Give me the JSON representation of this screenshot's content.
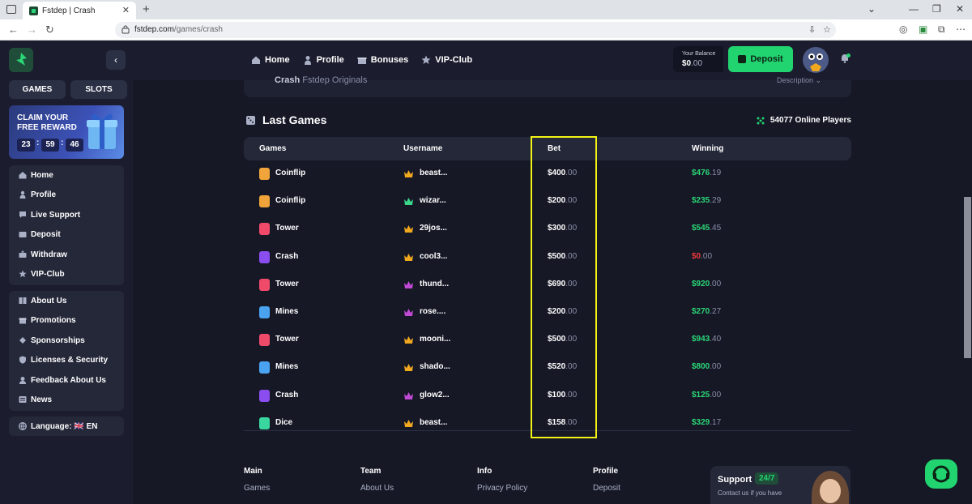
{
  "browser": {
    "tab_title": "Fstdep | Crash",
    "url_host": "fstdep.com",
    "url_path": "/games/crash"
  },
  "header": {
    "nav": [
      "Home",
      "Profile",
      "Bonuses",
      "VIP-Club"
    ],
    "balance_label": "Your Balance",
    "balance_main": "$0",
    "balance_cents": ".00",
    "deposit_label": "Deposit"
  },
  "sidebar": {
    "tabs": [
      "GAMES",
      "SLOTS"
    ],
    "reward_line1": "CLAIM YOUR",
    "reward_line2": "FREE REWARD",
    "timer": [
      "23",
      "59",
      "46"
    ],
    "group1": [
      "Home",
      "Profile",
      "Live Support",
      "Deposit",
      "Withdraw",
      "VIP-Club"
    ],
    "group2": [
      "About Us",
      "Promotions",
      "Sponsorships",
      "Licenses & Security",
      "Feedback About Us",
      "News"
    ],
    "language": "Language: 🇬🇧 EN"
  },
  "crash_card": {
    "name": "Crash",
    "sub": "Fstdep Originals",
    "description": "Description"
  },
  "last_games": {
    "title": "Last Games",
    "online": "54077 Online Players",
    "columns": [
      "Games",
      "Username",
      "Bet",
      "Winning"
    ],
    "rows": [
      {
        "game": "Coinflip",
        "user": "beast...",
        "bet": "$400",
        "bet_c": ".00",
        "win": "$476",
        "win_c": ".19"
      },
      {
        "game": "Coinflip",
        "user": "wizar...",
        "bet": "$200",
        "bet_c": ".00",
        "win": "$235",
        "win_c": ".29"
      },
      {
        "game": "Tower",
        "user": "29jos...",
        "bet": "$300",
        "bet_c": ".00",
        "win": "$545",
        "win_c": ".45"
      },
      {
        "game": "Crash",
        "user": "cool3...",
        "bet": "$500",
        "bet_c": ".00",
        "win": "$0",
        "win_c": ".00"
      },
      {
        "game": "Tower",
        "user": "thund...",
        "bet": "$690",
        "bet_c": ".00",
        "win": "$920",
        "win_c": ".00"
      },
      {
        "game": "Mines",
        "user": "rose....",
        "bet": "$200",
        "bet_c": ".00",
        "win": "$270",
        "win_c": ".27"
      },
      {
        "game": "Tower",
        "user": "mooni...",
        "bet": "$500",
        "bet_c": ".00",
        "win": "$943",
        "win_c": ".40"
      },
      {
        "game": "Mines",
        "user": "shado...",
        "bet": "$520",
        "bet_c": ".00",
        "win": "$800",
        "win_c": ".00"
      },
      {
        "game": "Crash",
        "user": "glow2...",
        "bet": "$100",
        "bet_c": ".00",
        "win": "$125",
        "win_c": ".00"
      },
      {
        "game": "Dice",
        "user": "beast...",
        "bet": "$158",
        "bet_c": ".00",
        "win": "$329",
        "win_c": ".17"
      }
    ]
  },
  "footer": {
    "cols": [
      {
        "head": "Main",
        "link": "Games"
      },
      {
        "head": "Team",
        "link": "About Us"
      },
      {
        "head": "Info",
        "link": "Privacy Policy"
      },
      {
        "head": "Profile",
        "link": "Deposit"
      }
    ],
    "support_title": "Support",
    "support_badge": "24/7",
    "support_sub": "Contact us if you have"
  },
  "colors": {
    "accent_green": "#22d46f",
    "loss_red": "#ee3a3a",
    "highlight_yellow": "#f2f214"
  }
}
